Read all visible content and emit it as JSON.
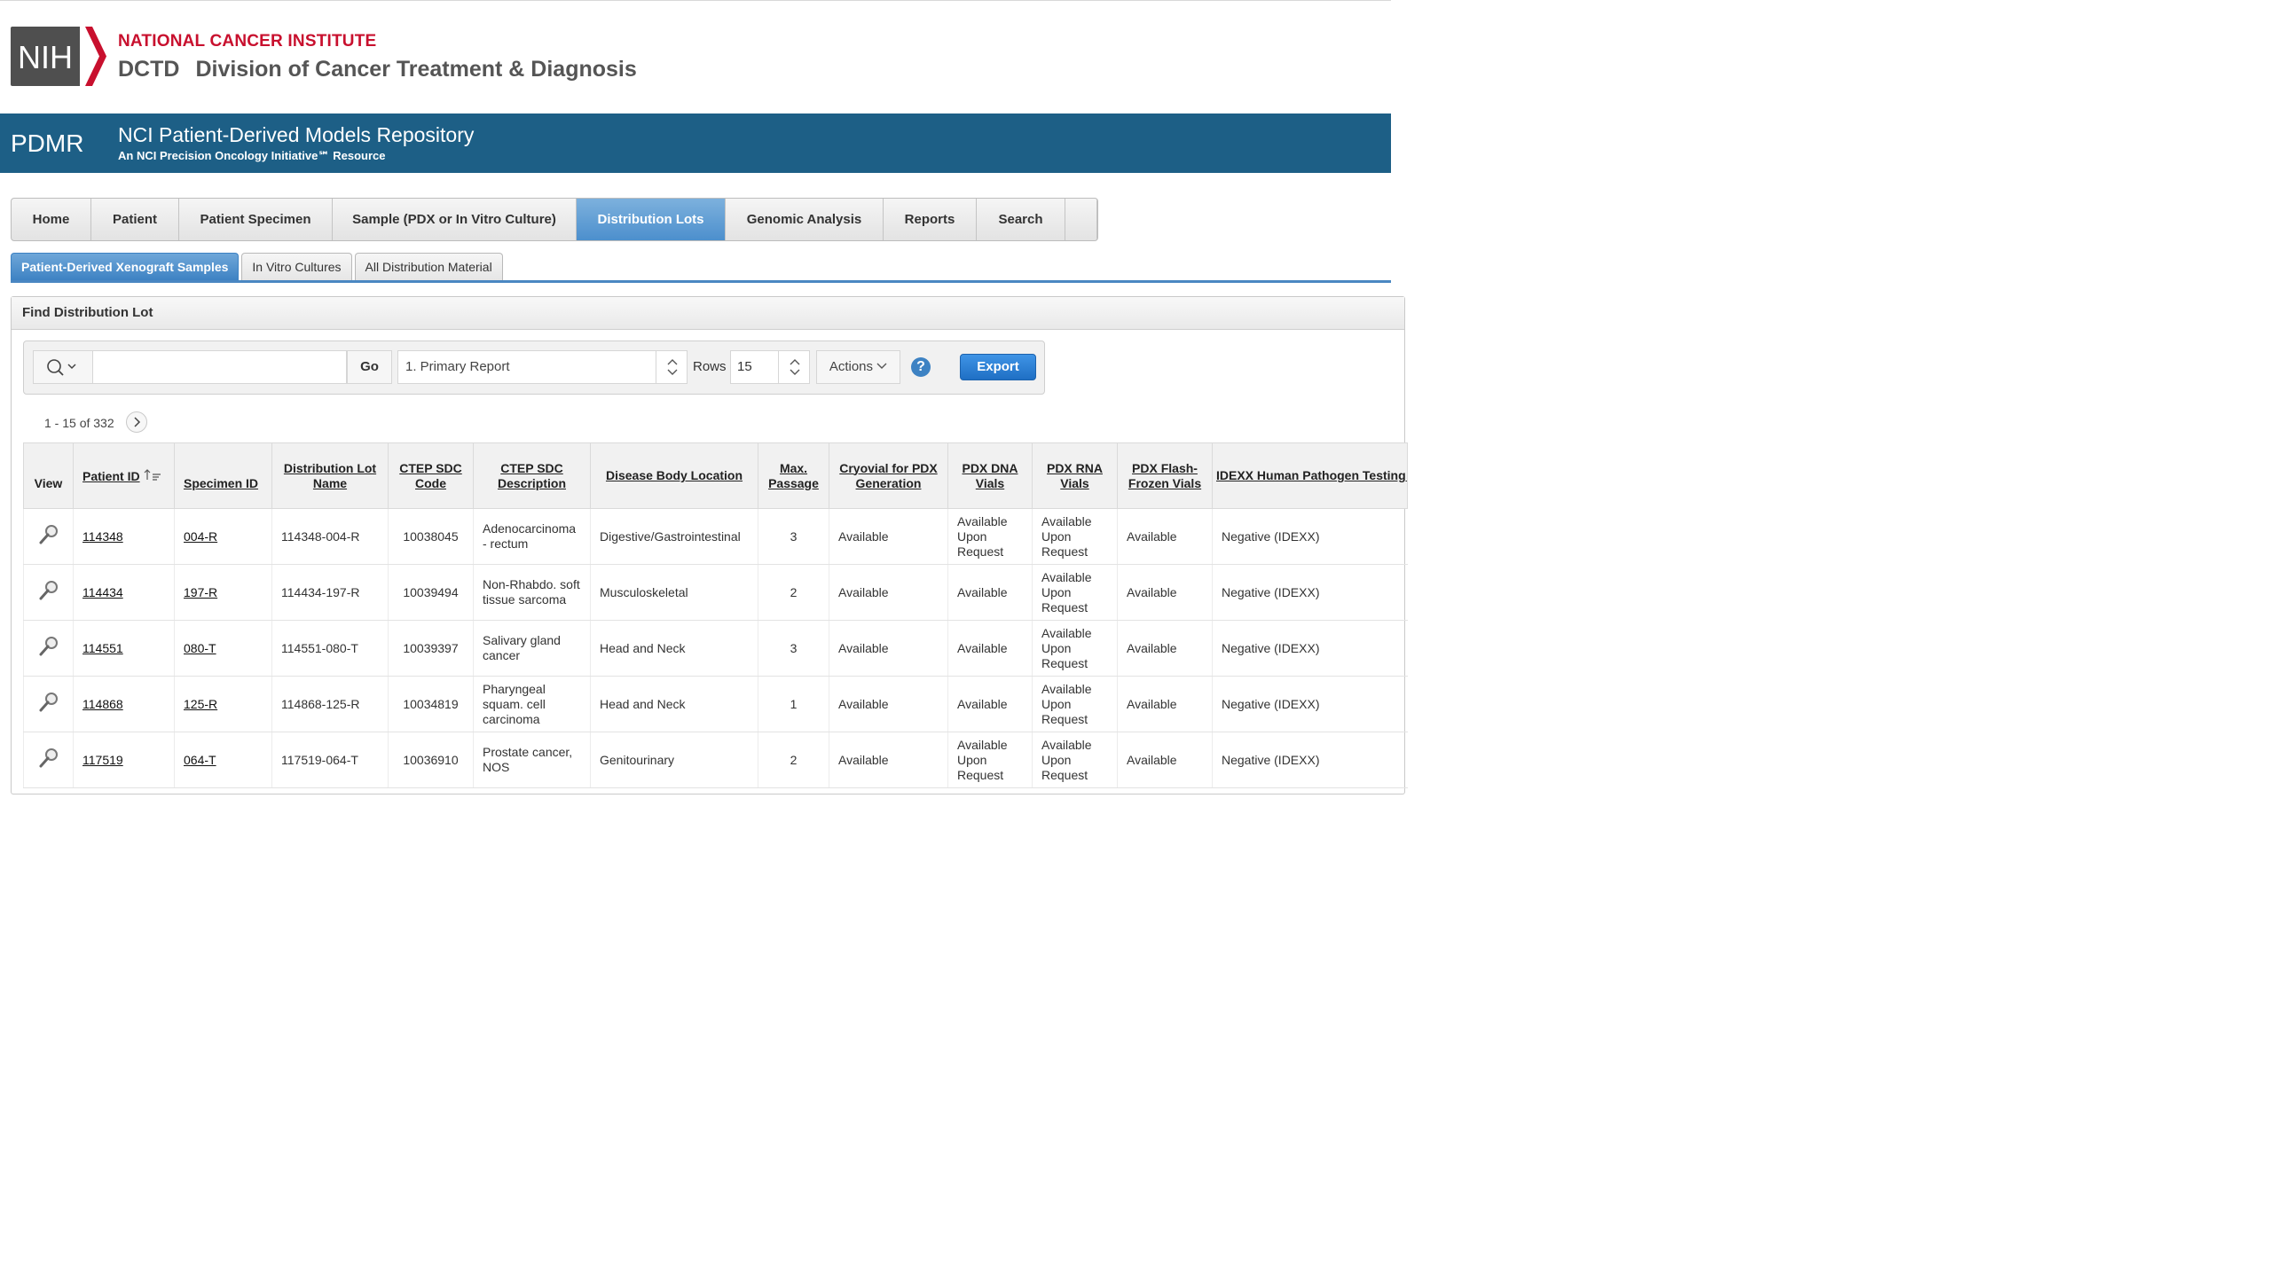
{
  "brand": {
    "nih_logo_text": "NIH",
    "title": "NATIONAL CANCER INSTITUTE",
    "sub_abbr": "DCTD",
    "sub_full": "Division of Cancer Treatment & Diagnosis"
  },
  "banner": {
    "short": "PDMR",
    "title": "NCI Patient-Derived Models Repository",
    "tagline": "An NCI Precision Oncology Initiative℠ Resource"
  },
  "nav": {
    "tabs": [
      "Home",
      "Patient",
      "Patient Specimen",
      "Sample (PDX or In Vitro Culture)",
      "Distribution Lots",
      "Genomic Analysis",
      "Reports",
      "Search",
      ""
    ],
    "active": "Distribution Lots"
  },
  "subtabs": {
    "items": [
      "Patient-Derived Xenograft Samples",
      "In Vitro Cultures",
      "All Distribution Material"
    ],
    "active": "Patient-Derived Xenograft Samples"
  },
  "region": {
    "title": "Find Distribution Lot"
  },
  "toolbar": {
    "search_value": "",
    "go_label": "Go",
    "report_value": "1. Primary Report",
    "rows_label": "Rows",
    "rows_value": "15",
    "actions_label": "Actions",
    "help_label": "?",
    "export_label": "Export"
  },
  "pagination": {
    "text": "1 - 15 of 332"
  },
  "table": {
    "columns": [
      "View",
      "Patient ID",
      "Specimen ID",
      "Distribution Lot Name",
      "CTEP SDC Code",
      "CTEP SDC Description",
      "Disease Body Location",
      "Max. Passage",
      "Cryovial for PDX Generation",
      "PDX DNA Vials",
      "PDX RNA Vials",
      "PDX Flash-Frozen Vials",
      "IDEXX Human Pathogen Testing Summary (h-IMPACT)"
    ],
    "rows": [
      {
        "patient": "114348",
        "specimen": "004-R",
        "lot": "114348-004-R",
        "code": "10038045",
        "desc": "Adenocarcinoma - rectum",
        "location": "Digestive/Gastrointestinal",
        "passage": "3",
        "cryo": "Available",
        "dna": "Available Upon Request",
        "rna": "Available Upon Request",
        "flash": "Available",
        "idexx": "Negative (IDEXX)"
      },
      {
        "patient": "114434",
        "specimen": "197-R",
        "lot": "114434-197-R",
        "code": "10039494",
        "desc": "Non-Rhabdo. soft tissue sarcoma",
        "location": "Musculoskeletal",
        "passage": "2",
        "cryo": "Available",
        "dna": "Available",
        "rna": "Available Upon Request",
        "flash": "Available",
        "idexx": "Negative (IDEXX)"
      },
      {
        "patient": "114551",
        "specimen": "080-T",
        "lot": "114551-080-T",
        "code": "10039397",
        "desc": "Salivary gland cancer",
        "location": "Head and Neck",
        "passage": "3",
        "cryo": "Available",
        "dna": "Available",
        "rna": "Available Upon Request",
        "flash": "Available",
        "idexx": "Negative (IDEXX)"
      },
      {
        "patient": "114868",
        "specimen": "125-R",
        "lot": "114868-125-R",
        "code": "10034819",
        "desc": "Pharyngeal squam. cell carcinoma",
        "location": "Head and Neck",
        "passage": "1",
        "cryo": "Available",
        "dna": "Available",
        "rna": "Available Upon Request",
        "flash": "Available",
        "idexx": "Negative (IDEXX)"
      },
      {
        "patient": "117519",
        "specimen": "064-T",
        "lot": "117519-064-T",
        "code": "10036910",
        "desc": "Prostate cancer, NOS",
        "location": "Genitourinary",
        "passage": "2",
        "cryo": "Available",
        "dna": "Available Upon Request",
        "rna": "Available Upon Request",
        "flash": "Available",
        "idexx": "Negative (IDEXX)"
      }
    ]
  },
  "colors": {
    "nci_red": "#c8102e",
    "banner_blue": "#1d5f86",
    "active_tab": "#4c8fcd",
    "export_blue": "#1f6fc4"
  },
  "icons": {
    "view": "magnifier-icon",
    "search": "search-icon",
    "sort": "sort-ascending-icon",
    "next": "chevron-right-icon",
    "help": "help-icon"
  }
}
